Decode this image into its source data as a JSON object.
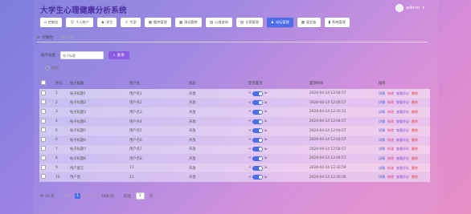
{
  "app": {
    "title": "大学生心理健康分析系统"
  },
  "user": {
    "name": "admin"
  },
  "nav": [
    {
      "label": "控制台",
      "icon": "home-icon",
      "active": false
    },
    {
      "label": "个人账户",
      "icon": "user-icon",
      "active": false
    },
    {
      "label": "学生",
      "icon": "student-icon",
      "active": false
    },
    {
      "label": "专家",
      "icon": "expert-icon",
      "active": false
    },
    {
      "label": "题库管理",
      "icon": "grid-icon",
      "active": false
    },
    {
      "label": "测试题库",
      "icon": "grid-icon",
      "active": false
    },
    {
      "label": "心理咨询",
      "icon": "book-icon",
      "active": false
    },
    {
      "label": "文章管理",
      "icon": "book-icon",
      "active": false
    },
    {
      "label": "论坛管理",
      "icon": "person-icon",
      "active": true
    },
    {
      "label": "留言板",
      "icon": "grid-icon",
      "active": false
    },
    {
      "label": "系统管理",
      "icon": "chart-icon",
      "active": false
    }
  ],
  "breadcrumb": {
    "home": "控制台",
    "sep": "/",
    "current": "论坛交流"
  },
  "search": {
    "label": "帖子标题",
    "placeholder": "帖子标题",
    "button": "查询"
  },
  "delete_label": "删除",
  "table": {
    "headers": [
      "序号",
      "帖子标题",
      "用户名",
      "状态",
      "是否置顶",
      "置顶时间",
      "操作"
    ],
    "rows": [
      {
        "idx": "1",
        "title": "帖子标题1",
        "user": "用户名1",
        "status": "开放",
        "time": "2024-04-14 12:04:57"
      },
      {
        "idx": "2",
        "title": "帖子标题2",
        "user": "用户名2",
        "status": "开放",
        "time": "2024-04-14 12:04:57"
      },
      {
        "idx": "3",
        "title": "帖子标题3",
        "user": "用户名3",
        "status": "开放",
        "time": "2024-04-14 12:35:31"
      },
      {
        "idx": "4",
        "title": "帖子标题4",
        "user": "用户名4",
        "status": "开放",
        "time": "2024-04-14 12:04:57"
      },
      {
        "idx": "5",
        "title": "帖子标题5",
        "user": "用户名5",
        "status": "开放",
        "time": "2024-04-14 12:04:57"
      },
      {
        "idx": "6",
        "title": "帖子标题6",
        "user": "用户名6",
        "status": "开放",
        "time": "2024-04-14 12:04:57"
      },
      {
        "idx": "7",
        "title": "帖子标题7",
        "user": "用户名7",
        "status": "开放",
        "time": "2024-04-14 12:04:57"
      },
      {
        "idx": "8",
        "title": "帖子标题8",
        "user": "用户名8",
        "status": "开放",
        "time": "2024-04-14 12:04:57"
      },
      {
        "idx": "9",
        "title": "用户留言",
        "user": "11",
        "status": "开放",
        "time": "2024-04-14 12:32:59"
      },
      {
        "idx": "10",
        "title": "用户留",
        "user": "11",
        "status": "开放",
        "time": "2024-04-14 12:35:06"
      }
    ],
    "toggle_left": "<",
    "toggle_right": "≥",
    "actions": [
      "详情",
      "修改",
      "查看评论",
      "删除"
    ]
  },
  "pager": {
    "total": "共 10 条",
    "prev": "上一页",
    "page": "1",
    "next": "下一页",
    "size": "10条/页",
    "goto": "前往",
    "goto_page": "1",
    "unit": "页"
  },
  "colors": {
    "accent": "#4b6ee8",
    "search": "#8a5be0",
    "title": "#4a2ea0"
  }
}
